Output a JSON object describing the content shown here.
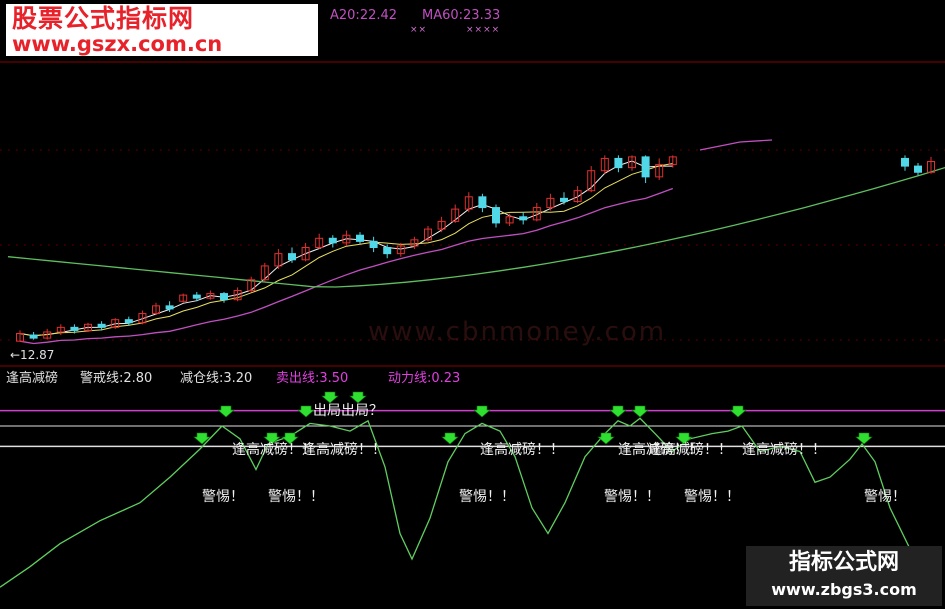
{
  "watermark": {
    "site_name": "股票公式指标网",
    "site_url": "www.gszx.com.cn",
    "center_text": "www.cbnmoney.com",
    "badge_title": "指标公式网",
    "badge_url": "www.zbgs3.com"
  },
  "top_legend": {
    "ma20": "A20:22.42",
    "ma60": "MA60:23.33",
    "marks_a": "××",
    "marks_b": "××××",
    "colors": {
      "ma20": "#c050c0",
      "ma60": "#c050c0"
    }
  },
  "price_low_label": "←12.87",
  "indicator_legend": {
    "name": "逢高减磅",
    "warn": "警戒线:2.80",
    "reduce": "减仓线:3.20",
    "sell": "卖出线:3.50",
    "power": "动力线:0.23",
    "colors": {
      "name": "#e0e0e0",
      "warn": "#e0e0e0",
      "reduce": "#e0e0e0",
      "sell": "#e040e0",
      "power": "#e040e0"
    }
  },
  "annotations": {
    "exit": "出局出局？",
    "sell_signals": [
      "逢高减磅！！",
      "逢高减磅！！",
      "逢高减磅！！",
      "逢高减磅！！",
      "逢高减磅！！",
      "逢高减磅！！"
    ],
    "warnings": [
      "警惕！",
      "警惕！！",
      "警惕！！",
      "警惕！！",
      "警惕！！",
      "警惕！"
    ]
  },
  "chart_data": {
    "type": "line",
    "candles": [
      {
        "o": 12.9,
        "c": 13.4,
        "h": 13.6,
        "l": 12.87
      },
      {
        "o": 13.3,
        "c": 13.1,
        "h": 13.5,
        "l": 13.0
      },
      {
        "o": 13.1,
        "c": 13.5,
        "h": 13.7,
        "l": 13.0
      },
      {
        "o": 13.5,
        "c": 13.8,
        "h": 14.0,
        "l": 13.3
      },
      {
        "o": 13.8,
        "c": 13.6,
        "h": 14.0,
        "l": 13.4
      },
      {
        "o": 13.6,
        "c": 14.0,
        "h": 14.1,
        "l": 13.5
      },
      {
        "o": 14.0,
        "c": 13.8,
        "h": 14.2,
        "l": 13.6
      },
      {
        "o": 13.8,
        "c": 14.3,
        "h": 14.4,
        "l": 13.7
      },
      {
        "o": 14.3,
        "c": 14.1,
        "h": 14.5,
        "l": 13.9
      },
      {
        "o": 14.1,
        "c": 14.7,
        "h": 14.9,
        "l": 14.0
      },
      {
        "o": 14.7,
        "c": 15.2,
        "h": 15.4,
        "l": 14.6
      },
      {
        "o": 15.2,
        "c": 15.0,
        "h": 15.5,
        "l": 14.8
      },
      {
        "o": 15.5,
        "c": 15.9,
        "h": 16.0,
        "l": 15.4
      },
      {
        "o": 15.9,
        "c": 15.7,
        "h": 16.1,
        "l": 15.5
      },
      {
        "o": 15.7,
        "c": 16.0,
        "h": 16.2,
        "l": 15.6
      },
      {
        "o": 16.0,
        "c": 15.6,
        "h": 16.1,
        "l": 15.4
      },
      {
        "o": 15.6,
        "c": 16.2,
        "h": 16.4,
        "l": 15.5
      },
      {
        "o": 16.2,
        "c": 16.9,
        "h": 17.1,
        "l": 16.1
      },
      {
        "o": 16.9,
        "c": 17.8,
        "h": 18.0,
        "l": 16.8
      },
      {
        "o": 17.8,
        "c": 18.6,
        "h": 18.9,
        "l": 17.6
      },
      {
        "o": 18.6,
        "c": 18.2,
        "h": 19.0,
        "l": 18.0
      },
      {
        "o": 18.2,
        "c": 19.0,
        "h": 19.3,
        "l": 18.1
      },
      {
        "o": 19.0,
        "c": 19.6,
        "h": 19.9,
        "l": 18.9
      },
      {
        "o": 19.6,
        "c": 19.3,
        "h": 19.8,
        "l": 19.0
      },
      {
        "o": 19.3,
        "c": 19.8,
        "h": 20.1,
        "l": 19.1
      },
      {
        "o": 19.8,
        "c": 19.4,
        "h": 20.0,
        "l": 19.2
      },
      {
        "o": 19.4,
        "c": 19.0,
        "h": 19.7,
        "l": 18.7
      },
      {
        "o": 19.0,
        "c": 18.6,
        "h": 19.2,
        "l": 18.3
      },
      {
        "o": 18.6,
        "c": 19.1,
        "h": 19.3,
        "l": 18.4
      },
      {
        "o": 19.1,
        "c": 19.5,
        "h": 19.7,
        "l": 18.9
      },
      {
        "o": 19.5,
        "c": 20.2,
        "h": 20.4,
        "l": 19.4
      },
      {
        "o": 20.2,
        "c": 20.7,
        "h": 21.0,
        "l": 20.0
      },
      {
        "o": 20.7,
        "c": 21.5,
        "h": 21.8,
        "l": 20.6
      },
      {
        "o": 21.5,
        "c": 22.3,
        "h": 22.6,
        "l": 21.3
      },
      {
        "o": 22.3,
        "c": 21.6,
        "h": 22.5,
        "l": 21.3
      },
      {
        "o": 21.6,
        "c": 20.6,
        "h": 21.8,
        "l": 20.3
      },
      {
        "o": 20.6,
        "c": 21.0,
        "h": 21.2,
        "l": 20.4
      },
      {
        "o": 21.0,
        "c": 20.8,
        "h": 21.3,
        "l": 20.5
      },
      {
        "o": 20.8,
        "c": 21.6,
        "h": 21.9,
        "l": 20.7
      },
      {
        "o": 21.6,
        "c": 22.2,
        "h": 22.5,
        "l": 21.4
      },
      {
        "o": 22.2,
        "c": 22.0,
        "h": 22.6,
        "l": 21.8
      },
      {
        "o": 22.0,
        "c": 22.7,
        "h": 23.0,
        "l": 21.9
      },
      {
        "o": 22.7,
        "c": 24.0,
        "h": 24.3,
        "l": 22.6
      },
      {
        "o": 24.0,
        "c": 24.8,
        "h": 25.0,
        "l": 23.8
      },
      {
        "o": 24.8,
        "c": 24.2,
        "h": 25.0,
        "l": 23.9
      },
      {
        "o": 24.2,
        "c": 24.9,
        "h": 25.0,
        "l": 24.0
      },
      {
        "o": 24.9,
        "c": 23.6,
        "h": 25.0,
        "l": 23.2
      },
      {
        "o": 23.6,
        "c": 24.4,
        "h": 24.8,
        "l": 23.4
      },
      {
        "o": 24.4,
        "c": 24.9,
        "h": 25.0,
        "l": 24.2
      }
    ],
    "late_candles": [
      {
        "o": 24.8,
        "c": 24.3,
        "h": 25.0,
        "l": 24.0
      },
      {
        "o": 24.3,
        "c": 23.9,
        "h": 24.5,
        "l": 23.7
      },
      {
        "o": 23.9,
        "c": 24.6,
        "h": 24.9,
        "l": 23.8
      }
    ],
    "ylim": [
      12,
      26
    ],
    "indicator_levels": {
      "warn": 2.8,
      "reduce": 3.2,
      "sell": 3.5
    },
    "indicator_ylim": [
      -0.2,
      4.0
    ]
  }
}
